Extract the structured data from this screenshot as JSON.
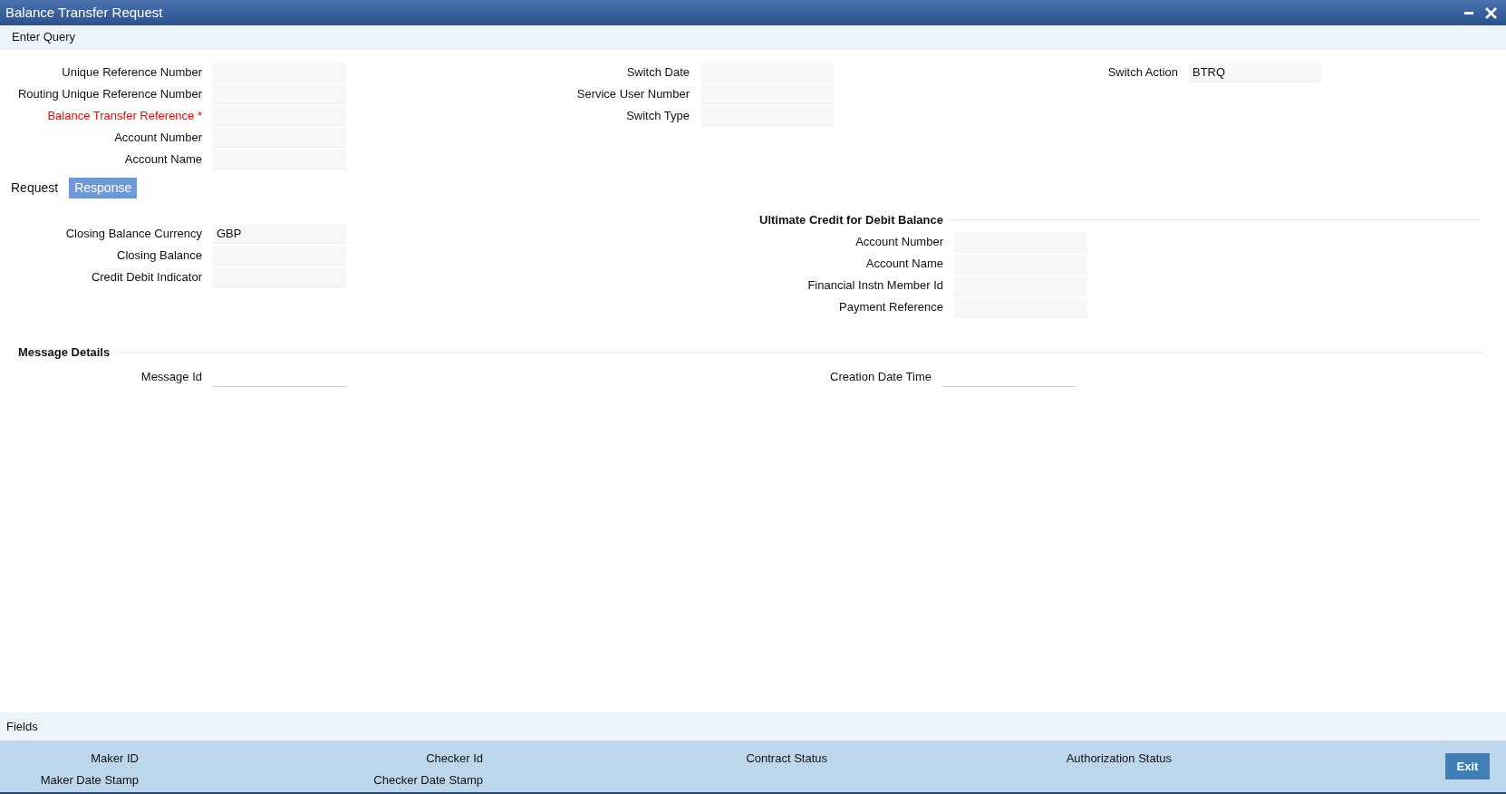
{
  "window": {
    "title": "Balance Transfer Request"
  },
  "toolbar": [
    "Enter Query"
  ],
  "header": {
    "columns": [
      [
        {
          "label": "Unique Reference Number",
          "required": false
        },
        {
          "label": "Routing Unique Reference Number",
          "required": false
        },
        {
          "label": "Balance Transfer Reference *",
          "required": true
        },
        {
          "label": "Account Number",
          "required": false
        },
        {
          "label": "Account Name",
          "required": false
        }
      ],
      [
        {
          "label": "Switch Date",
          "required": false
        },
        {
          "label": "Service User Number",
          "required": false
        },
        {
          "label": "Switch Type",
          "required": false
        }
      ],
      [
        {
          "label": "Switch Action",
          "value": "BTRQ",
          "required": false
        }
      ]
    ]
  },
  "tabs": [
    {
      "label": "Request",
      "selected": false
    },
    {
      "label": "Response",
      "selected": true
    }
  ],
  "response": {
    "fields": [
      {
        "label": "Closing Balance Currency",
        "value": "GBP"
      },
      {
        "label": "Closing Balance"
      },
      {
        "label": "Credit Debit Indicator"
      }
    ],
    "group": {
      "title": "Ultimate Credit for Debit Balance",
      "fields": [
        {
          "label": "Account Number"
        },
        {
          "label": "Account Name"
        },
        {
          "label": "Financial Instn Member Id"
        },
        {
          "label": "Payment Reference"
        }
      ]
    }
  },
  "message_details": {
    "title": "Message Details",
    "fields": [
      {
        "label": "Message Id"
      },
      {
        "label": "Creation Date Time"
      }
    ]
  },
  "footer": {
    "title": "Fields",
    "audit": [
      [
        "Maker ID",
        "Maker Date Stamp"
      ],
      [
        "Checker Id",
        "Checker Date Stamp"
      ],
      [
        "Contract Status"
      ],
      [
        "Authorization Status"
      ]
    ],
    "button": "Exit"
  }
}
